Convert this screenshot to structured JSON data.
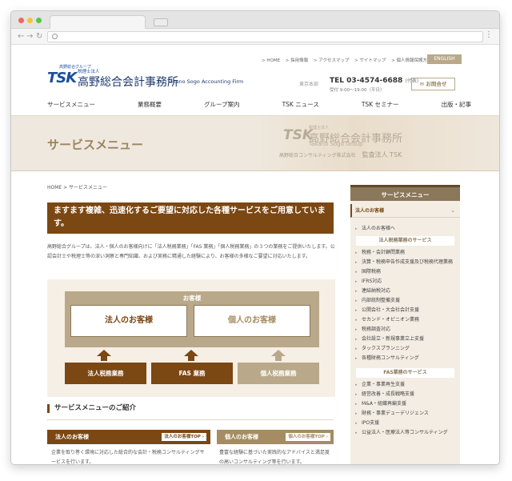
{
  "header": {
    "toplinks": [
      "> HOME",
      "> 採用情報",
      "> アクセスマップ",
      "> サイトマップ",
      "> 個人情報保護方針"
    ],
    "english": "ENGLISH",
    "logo_group": "高野総合グループ",
    "logo_mark": "TSK",
    "logo_sub": "税理士法人",
    "logo_name": "高野総合会計事務所",
    "logo_en": "Takano Sogo Accounting Firm",
    "hq": "東京本部",
    "tel_label": "TEL",
    "tel": "03-4574-6688",
    "tel_note": "(代表)",
    "hours": "受付 9:00〜19:00（平日）",
    "contact": "お問合せ"
  },
  "gnav": [
    "サービスメニュー",
    "業務概要",
    "グループ案内",
    "TSK ニュース",
    "TSK セミナー",
    "出版・記事"
  ],
  "hero": {
    "title": "サービスメニュー",
    "logo_mark": "TSK",
    "logo_sub": "税理士法人",
    "logo_name": "高野総合会計事務所",
    "logo_en": "Takano Sogo Group",
    "foot_left": "高野総合コンサルティング株式会社",
    "foot_right": "監査法人 TSK"
  },
  "breadcrumb": "HOME > サービスメニュー",
  "banner": "ますます複雑、迅速化するご要望に対応した各種サービスをご用意しています。",
  "intro": "高野総合グループは、法人・個人のお客様向けに「法人税務業務」「FAS 業務」「個人税務業務」の３つの業務をご提供いたします。公認会計士や税理士等の深い洞察と専門知識、および実務に精通した経験により、お客様の多様なご要望に対応いたします。",
  "diagram": {
    "customers": "お客様",
    "corp_client": "法人のお客様",
    "indiv_client": "個人のお客様",
    "services": [
      "法人税務業務",
      "FAS 業務",
      "個人税務業務"
    ]
  },
  "section_heading": "サービスメニューのご紹介",
  "cards": {
    "corp_title": "法人のお客様",
    "corp_btn": "法人のお客様TOP",
    "corp_desc": "企業を取り巻く環境に対応した総合的な会計・税務コンサルティングサービスを行います。",
    "indiv_title": "個人のお客様",
    "indiv_btn": "個人のお客様TOP",
    "indiv_desc": "豊富な経験に基づいた実践的なアドバイスと満足度の高いコンサルティング等を行います。"
  },
  "sidebar": {
    "title": "サービスメニュー",
    "toggle": "法人のお客様",
    "corp_top": "法人のお客様へ",
    "sub1": "法人税務業務のサービス",
    "items1": [
      "税務・会計顧問業務",
      "決算・税務申告作成支援及び税務代理業務",
      "国際税務",
      "IFRS対応",
      "連結納税対応",
      "内部統制整備支援",
      "公開会社・大会社会計支援",
      "セカンド・オピニオン業務",
      "税務調査対応",
      "会社設立・新規事業立上支援",
      "タックスプランニング",
      "各種財務コンサルティング"
    ],
    "sub2": "FAS業務のサービス",
    "items2": [
      "企業・事業再生支援",
      "経営改善・成長戦略支援",
      "M&A・組織再編支援",
      "財務・事業デューデリジェンス",
      "IPO支援",
      "公益法人・医療法人等コンサルティング"
    ]
  },
  "colors": {
    "brown": "#7b4713",
    "beige": "#b9a98a",
    "navy": "#1d3a6e"
  }
}
